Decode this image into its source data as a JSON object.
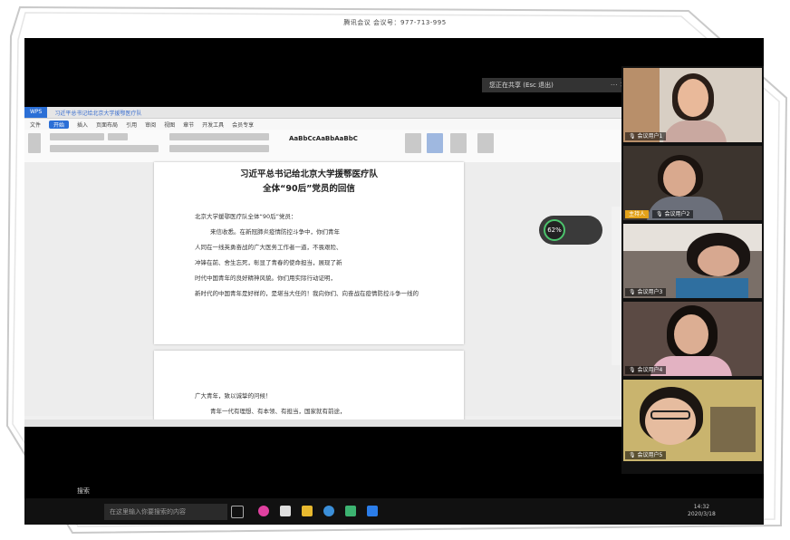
{
  "meeting": {
    "id_text": "腾讯会议 会议号：977-713-995",
    "share_notice": "您正在共享 (Esc 退出)"
  },
  "editor": {
    "app_tab": "WPS",
    "doc_tab": "习近平总书记给北京大学援鄂医疗队",
    "menu": [
      "文件",
      "开始",
      "插入",
      "页面布局",
      "引用",
      "审阅",
      "视图",
      "章节",
      "开发工具",
      "会员专享"
    ],
    "active_menu": "开始",
    "style_samples": "AaBbCcAaBbAaBbC",
    "zoom_label": "62%",
    "document": {
      "title_line1": "习近平总书记给北京大学援鄂医疗队",
      "title_line2": "全体“90后”党员的回信",
      "lines": [
        "北京大学援鄂医疗队全体“90后”党员：",
        "来信收悉。在新冠肺炎疫情防控斗争中，你们青年",
        "人同在一线英勇奋战的广大医务工作者一道，不畏艰险、",
        "冲锋在前、舍生忘死，彰显了青春的使命担当，展现了新",
        "时代中国青年的良好精神风貌。你们用实际行动证明，",
        "新时代的中国青年是好样的，是堪当大任的！我向你们、向奋战在疫情防控斗争一线的"
      ],
      "page2_lines": [
        "广大青年，致以诚挚的问候！",
        "青年一代有理想、有本领、有担当，国家就有前途，"
      ]
    }
  },
  "participants": [
    {
      "name": "会议用户1",
      "badge": ""
    },
    {
      "name": "会议用户2",
      "badge": "主持人"
    },
    {
      "name": "会议用户3",
      "badge": ""
    },
    {
      "name": "会议用户4",
      "badge": ""
    },
    {
      "name": "会议用户5",
      "badge": ""
    }
  ],
  "taskbar": {
    "start_text": "搜索",
    "search_placeholder": "在这里输入你要搜索的内容",
    "time": "14:32",
    "date": "2020/3/18"
  }
}
